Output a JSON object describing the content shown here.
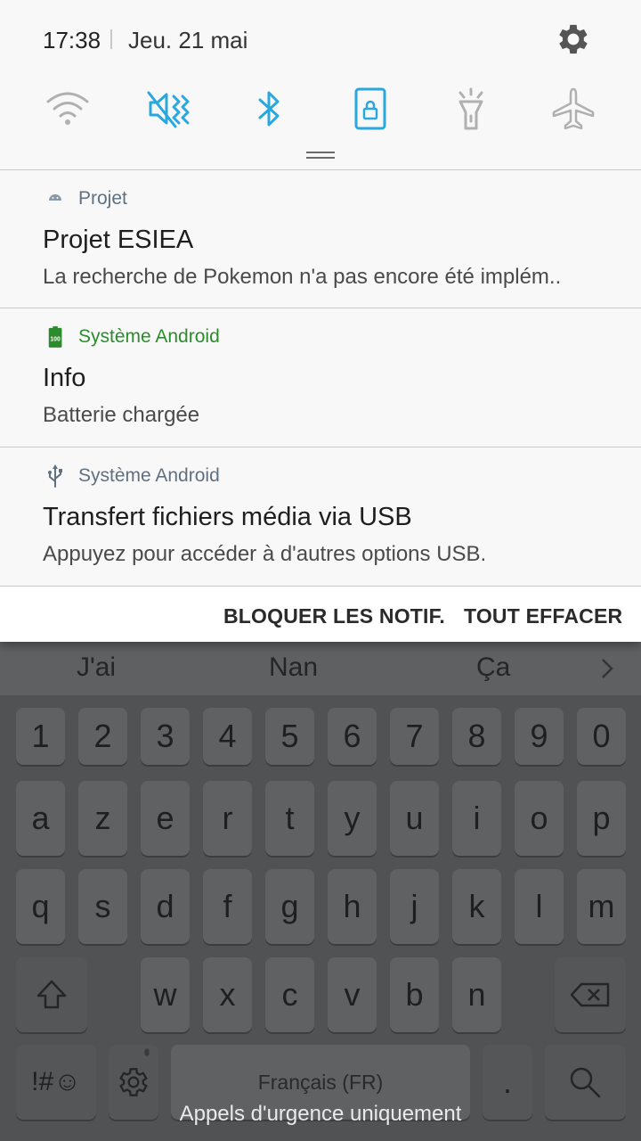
{
  "status": {
    "time": "17:38",
    "date": "Jeu. 21 mai"
  },
  "quick_settings": [
    {
      "icon": "wifi-icon",
      "active": false
    },
    {
      "icon": "mute-icon",
      "active": true
    },
    {
      "icon": "bluetooth-icon",
      "active": true
    },
    {
      "icon": "rotation-lock-icon",
      "active": true
    },
    {
      "icon": "flashlight-icon",
      "active": false
    },
    {
      "icon": "airplane-icon",
      "active": false
    }
  ],
  "notifications": [
    {
      "app": "Projet",
      "title": "Projet ESIEA",
      "text": "La recherche de Pokemon n'a pas encore été implém..",
      "icon": "android-icon"
    },
    {
      "app": "Système Android",
      "title": "Info",
      "text": "Batterie chargée",
      "icon": "battery-icon",
      "badge": "100"
    },
    {
      "app": "Système Android",
      "title": "Transfert fichiers média via USB",
      "text": "Appuyez pour accéder à d'autres options USB.",
      "icon": "usb-icon"
    }
  ],
  "actions": {
    "block": "BLOQUER LES NOTIF.",
    "clear": "TOUT EFFACER"
  },
  "keyboard": {
    "suggestions": [
      "J'ai",
      "Nan",
      "Ça"
    ],
    "row_numbers": [
      "1",
      "2",
      "3",
      "4",
      "5",
      "6",
      "7",
      "8",
      "9",
      "0"
    ],
    "row_1": [
      "a",
      "z",
      "e",
      "r",
      "t",
      "y",
      "u",
      "i",
      "o",
      "p"
    ],
    "row_2": [
      "q",
      "s",
      "d",
      "f",
      "g",
      "h",
      "j",
      "k",
      "l",
      "m"
    ],
    "row_3": [
      "w",
      "x",
      "c",
      "v",
      "b",
      "n"
    ],
    "symbols": "!#☺",
    "space": "Français (FR)",
    "period": "."
  },
  "emergency": "Appels d'urgence uniquement",
  "colors": {
    "accent": "#29a8e0",
    "inactive": "#a8a8a8",
    "android_green": "#2c8c2c"
  }
}
